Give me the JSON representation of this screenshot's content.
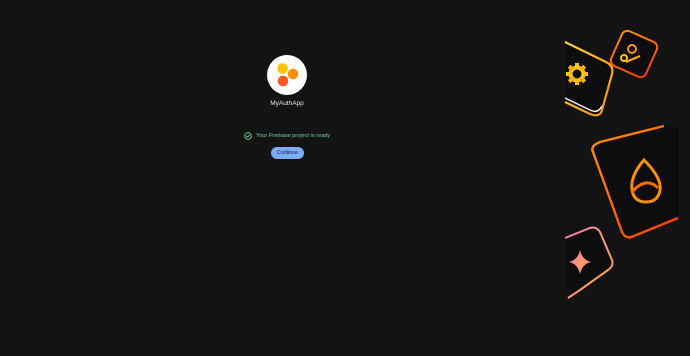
{
  "project": {
    "name": "MyAuthApp",
    "avatar_icon": "firebase-project-dots-icon"
  },
  "status": {
    "icon": "check-circle-icon",
    "text": "Your Firebase project is ready",
    "color": "#6dd58c"
  },
  "actions": {
    "continue_label": "Continue"
  },
  "colors": {
    "background": "#131314",
    "accent": "#7cacf8",
    "dot_yellow": "#ffc400",
    "dot_orange": "#ff9100",
    "dot_red": "#ff5722"
  },
  "decorations": {
    "icons": [
      "gear-tile-icon",
      "fire-tile-icon",
      "sparkle-tile-icon",
      "small-tile-icon"
    ]
  }
}
